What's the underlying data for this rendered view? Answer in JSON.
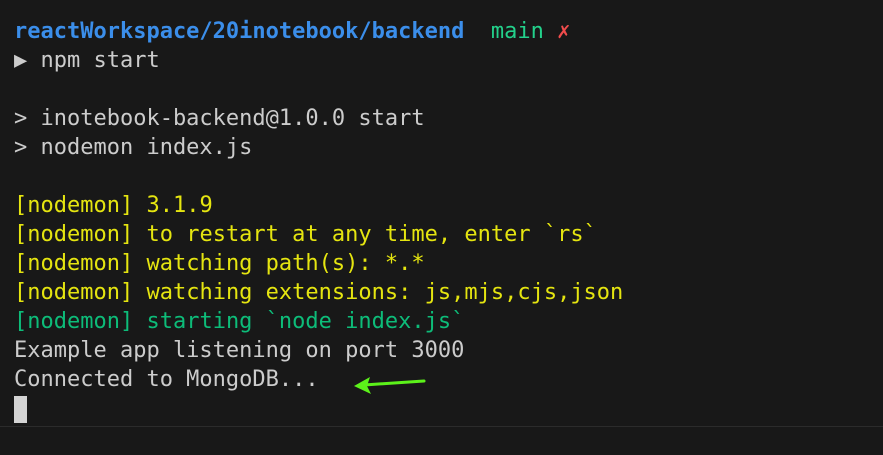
{
  "prompt": {
    "path": "reactWorkspace/20inotebook/backend",
    "branch": "main",
    "dirty_mark": "✗",
    "symbol": "▶",
    "command": "npm start"
  },
  "output": {
    "script_header": "> inotebook-backend@1.0.0 start",
    "script_command": "> nodemon index.js",
    "nodemon_tag": "[nodemon]",
    "nodemon_lines": [
      "3.1.9",
      "to restart at any time, enter `rs`",
      "watching path(s): *.*",
      "watching extensions: js,mjs,cjs,json"
    ],
    "nodemon_starting": "starting `node index.js`",
    "app_listening": "Example app listening on port 3000",
    "mongo_connected": "Connected to MongoDB..."
  },
  "colors": {
    "background": "#181818",
    "path": "#3b8eea",
    "branch": "#23d18b",
    "dirty": "#f14c4c",
    "nodemon_yellow": "#e5e510",
    "nodemon_green": "#0dbc79",
    "arrow": "#5cf21a"
  },
  "icons": {
    "annotation": "arrow-left-icon"
  }
}
